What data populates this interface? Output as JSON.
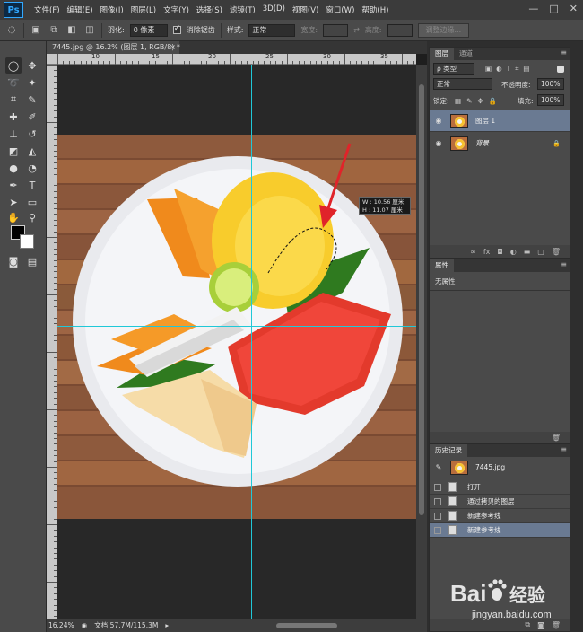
{
  "app": {
    "logo": "Ps"
  },
  "menu": [
    "文件(F)",
    "编辑(E)",
    "图像(I)",
    "图层(L)",
    "文字(Y)",
    "选择(S)",
    "滤镜(T)",
    "3D(D)",
    "视图(V)",
    "窗口(W)",
    "帮助(H)"
  ],
  "window_controls": [
    "—",
    "□",
    "✕"
  ],
  "options": {
    "feather_label": "羽化:",
    "feather_value": "0 像素",
    "antialias_label": "消除锯齿",
    "antialias_checked": true,
    "style_label": "样式:",
    "style_value": "正常",
    "width_label": "宽度:",
    "height_label": "高度:",
    "refine_label": "调整边缘..."
  },
  "document": {
    "tab_title": "7445.jpg @ 16.2% (图层 1, RGB/8) *",
    "close": "×"
  },
  "ruler": {
    "labels": [
      "10",
      "15",
      "20",
      "25",
      "30",
      "35"
    ]
  },
  "selection_tooltip": {
    "w": "W : 10.56 厘米",
    "h": "H : 11.07 厘米"
  },
  "status": {
    "zoom": "16.24%",
    "doc": "文档:57.7M/115.3M"
  },
  "layers_panel": {
    "tabs": [
      "图层",
      "通道"
    ],
    "filter_kind": "ρ 类型",
    "blend_mode": "正常",
    "opacity_label": "不透明度:",
    "opacity_value": "100%",
    "lock_label": "锁定:",
    "fill_label": "填充:",
    "fill_value": "100%",
    "layers": [
      {
        "name": "图层 1",
        "selected": true,
        "locked": false
      },
      {
        "name": "背景",
        "selected": false,
        "locked": true
      }
    ]
  },
  "properties_panel": {
    "title": "属性",
    "content": "无属性"
  },
  "history_panel": {
    "title": "历史记录",
    "snapshot": "7445.jpg",
    "items": [
      {
        "label": "打开",
        "selected": false
      },
      {
        "label": "通过拷贝的图层",
        "selected": false
      },
      {
        "label": "新建参考线",
        "selected": false
      },
      {
        "label": "新建参考线",
        "selected": true
      }
    ]
  },
  "watermark": {
    "brand": "Bai",
    "brand2": "经验",
    "url": "jingyan.baidu.com"
  },
  "colors": {
    "guide": "#20c8d8",
    "accent": "#31a8ff",
    "selected_row": "#6a7a92"
  }
}
